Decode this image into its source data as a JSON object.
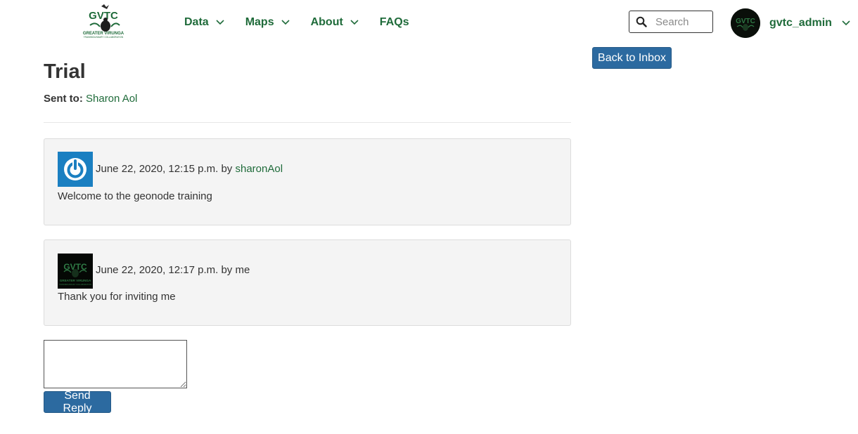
{
  "header": {
    "logo": {
      "text": "GVTC",
      "subtitle": "GREATER VIRUNGA",
      "tagline": "TRANSBOUNDARY COLLABORATION",
      "color": "#1f6b3a"
    },
    "nav": [
      {
        "label": "Data",
        "has_dropdown": true
      },
      {
        "label": "Maps",
        "has_dropdown": true
      },
      {
        "label": "About",
        "has_dropdown": true
      },
      {
        "label": "FAQs",
        "has_dropdown": false
      }
    ],
    "search": {
      "placeholder": "Search",
      "value": "",
      "icon": "search-icon"
    },
    "user": {
      "username": "gvtc_admin",
      "icon": "chevron-down-icon"
    }
  },
  "page": {
    "back_button": "Back to Inbox",
    "title": "Trial",
    "sent_to_label": "Sent to:",
    "sent_to_name": "Sharon Aol"
  },
  "messages": [
    {
      "timestamp": "June 22, 2020, 12:15 p.m. by ",
      "author": "sharonAol",
      "body": "Welcome to the geonode training",
      "avatar": "power-icon"
    },
    {
      "timestamp": "June 22, 2020, 12:17 p.m. by me",
      "author": "",
      "body": "Thank you for inviting me",
      "avatar": "gvtc-logo"
    }
  ],
  "reply": {
    "value": "",
    "send_label": "Send Reply"
  },
  "colors": {
    "brand_green": "#1f6b3a",
    "button_blue": "#2c6aa0",
    "message_bg": "#f4f4f4",
    "avatar_blue": "#1a7fc1"
  }
}
